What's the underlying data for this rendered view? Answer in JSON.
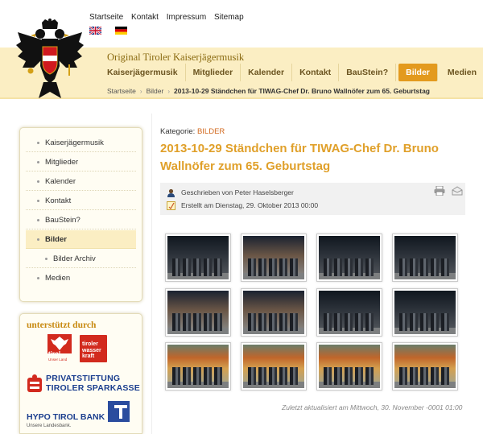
{
  "top_links": [
    "Startseite",
    "Kontakt",
    "Impressum",
    "Sitemap"
  ],
  "site_title": "Original Tiroler Kaiserjägermusik",
  "nav": [
    {
      "label": "Kaiserjägermusik"
    },
    {
      "label": "Mitglieder"
    },
    {
      "label": "Kalender"
    },
    {
      "label": "Kontakt"
    },
    {
      "label": "BauStein?"
    },
    {
      "label": "Bilder",
      "active": true
    },
    {
      "label": "Medien"
    }
  ],
  "breadcrumb": {
    "items": [
      "Startseite",
      "Bilder"
    ],
    "current": "2013-10-29 Ständchen für TIWAG-Chef Dr. Bruno Wallnöfer zum 65. Geburtstag"
  },
  "sidebar": [
    {
      "label": "Kaiserjägermusik"
    },
    {
      "label": "Mitglieder"
    },
    {
      "label": "Kalender"
    },
    {
      "label": "Kontakt"
    },
    {
      "label": "BauStein?"
    },
    {
      "label": "Bilder",
      "active": true
    },
    {
      "label": "Bilder Archiv",
      "sub": true
    },
    {
      "label": "Medien"
    }
  ],
  "sponsors": {
    "heading": "unterstützt durch",
    "tirol_text": "tirol",
    "tirol_sub": "Unser Land",
    "wasser_text": "tiroler wasser kraft",
    "sparkasse_line1": "PRIVATSTIFTUNG",
    "sparkasse_line2": "TIROLER SPARKASSE",
    "hypo_name": "HYPO TIROL BANK",
    "hypo_sub": "Unsere Landesbank."
  },
  "article": {
    "category_label": "Kategorie:",
    "category_value": "BILDER",
    "title": "2013-10-29 Ständchen für TIWAG-Chef Dr. Bruno Wallnöfer zum 65. Geburtstag",
    "author": "Geschrieben von Peter Haselsberger",
    "created": "Erstellt am Dienstag, 29. Oktober 2013 00:00",
    "updated": "Zuletzt aktualisiert am Mittwoch, 30. November -0001 01:00"
  },
  "gallery": [
    {
      "scene": "night"
    },
    {
      "scene": "dusk"
    },
    {
      "scene": "night"
    },
    {
      "scene": "night"
    },
    {
      "scene": "dusk"
    },
    {
      "scene": "dusk"
    },
    {
      "scene": "night"
    },
    {
      "scene": "night"
    },
    {
      "scene": "autumn"
    },
    {
      "scene": "autumn"
    },
    {
      "scene": "autumn"
    },
    {
      "scene": "autumn"
    }
  ],
  "colors": {
    "accent": "#e39a1e",
    "title": "#e0a02a",
    "band": "#fbeec3",
    "sponsor_blue": "#1c3f8f",
    "sponsor_red": "#d22a1e"
  },
  "icons": [
    "eagle-logo",
    "uk-flag",
    "german-flag",
    "author-icon",
    "calendar-icon",
    "print-icon",
    "email-icon"
  ]
}
